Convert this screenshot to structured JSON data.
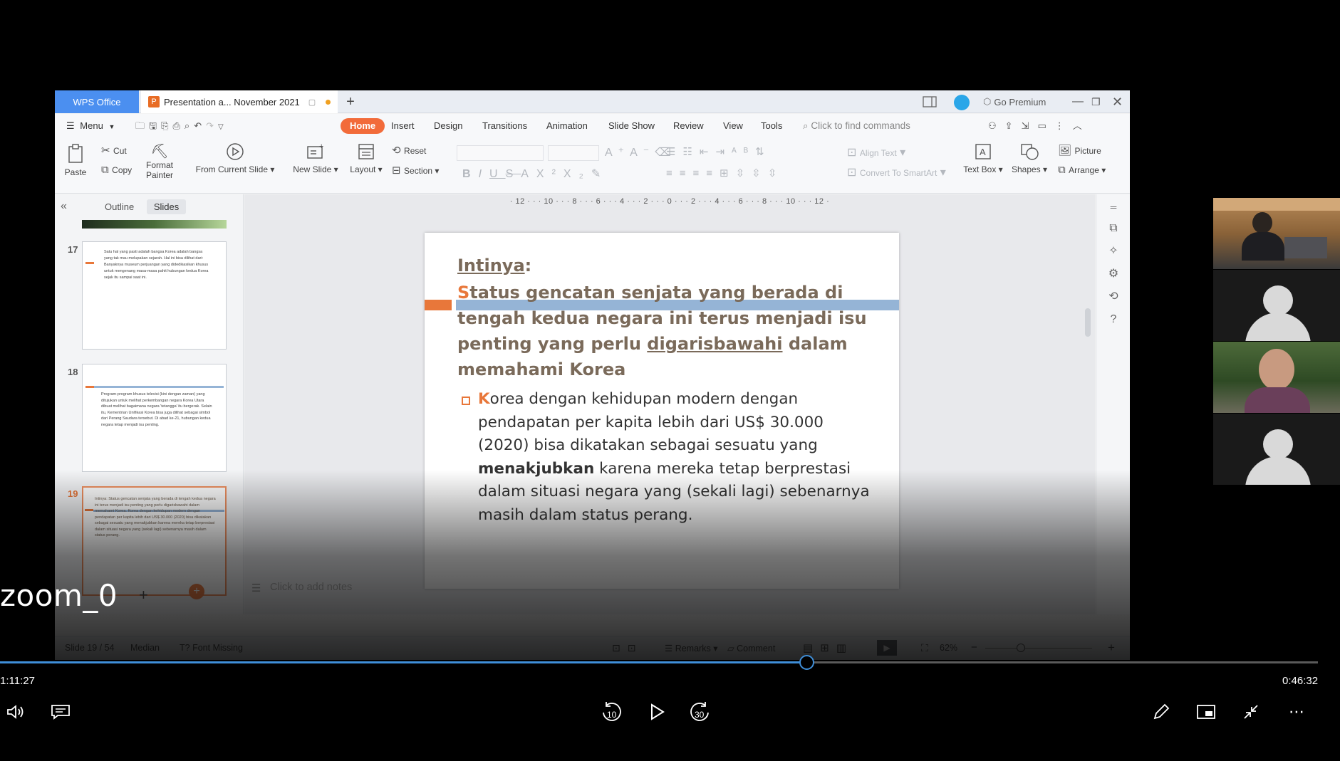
{
  "wps": {
    "app_tab": "WPS Office",
    "doc_tab": "Presentation a... November 2021",
    "go_premium": "Go Premium",
    "menu": "Menu",
    "tabs": [
      "Home",
      "Insert",
      "Design",
      "Transitions",
      "Animation",
      "Slide Show",
      "Review",
      "View",
      "Tools"
    ],
    "find_placeholder": "Click to find commands",
    "ribbon": {
      "paste": "Paste",
      "cut": "Cut",
      "copy": "Copy",
      "format_painter_1": "Format",
      "format_painter_2": "Painter",
      "from_current_slide": "From Current Slide",
      "new_slide": "New Slide",
      "layout": "Layout",
      "reset": "Reset",
      "section": "Section",
      "align_text": "Align Text",
      "convert_smartart": "Convert To SmartArt",
      "text_box": "Text Box",
      "shapes": "Shapes",
      "picture": "Picture",
      "arrange": "Arrange"
    },
    "panel_tabs": {
      "outline": "Outline",
      "slides": "Slides"
    },
    "thumbnails": [
      {
        "num": "17",
        "text": "Satu hal yang pasti adalah bangsa Korea adalah bangsa yang tak mau melupakan sejarah. Hal ini bisa dilihat dari: Banyaknya museum perjuangan yang didedikasikan khusus untuk mengenang masa-masa pahit hubungan kedua Korea sejak itu sampai saat ini."
      },
      {
        "num": "18",
        "text": "Program-program khusus televisi (kini dengan zaman) yang ditujukan untuk melihat perkembangan negara Korea Utara dibuat melihat bagaimana negara 'tetangga' itu bergerak. Selain itu, Kementrian Unifikasi Korea bisa juga dilihat sebagai simbol dari Perang Saudara tersebut. Di abad ke-21, hubungan kedua negara tetap menjadi isu penting."
      },
      {
        "num": "19",
        "text": "Intinya: Status gencatan senjata yang berada di tengah kedua negara ini terus menjadi isu penting yang perlu digarisbawahi dalam memahami Korea. Korea dengan kehidupan modern dengan pendapatan per kapita lebih dari US$ 30.000 (2020) bisa dikatakan sebagai sesuatu yang menakjubkan karena mereka tetap berprestasi dalam situasi negara yang (sekali lagi) sebenarnya masih dalam status perang."
      }
    ],
    "ruler": "· 12 · · · 10 · · · 8 · · · 6 · · · 4 · · · 2 · · · 0 · · · 2 · · · 4 · · · 6 · · · 8 · · · 10 · · · 12 ·",
    "slide": {
      "heading": "Intinya",
      "heading_colon": ":",
      "main_first_letter": "S",
      "main_rest_1": "tatus gencatan senjata yang berada di",
      "main_line_2": "tengah kedua negara ini terus menjadi isu",
      "main_line_3a": "penting yang perlu ",
      "main_line_3b": "digarisbawahi",
      "main_line_3c": " dalam",
      "main_line_4": "memahami Korea",
      "bullet_first_letter": "K",
      "bullet_l1": "orea dengan kehidupan modern dengan",
      "bullet_l2": "pendapatan per kapita lebih dari US$ 30.000",
      "bullet_l3": "(2020) bisa dikatakan sebagai sesuatu yang",
      "bullet_l4_bold": "menakjubkan",
      "bullet_l4_rest": " karena mereka tetap berprestasi",
      "bullet_l5": "dalam situasi negara yang (sekali lagi) sebenarnya",
      "bullet_l6": "masih dalam status perang."
    },
    "notes_placeholder": "Click to add notes",
    "status": {
      "slide_counter": "Slide 19 / 54",
      "theme": "Median",
      "font_missing": "Font Missing",
      "remarks": "Remarks",
      "comment": "Comment",
      "zoom": "62%"
    },
    "colors": {
      "accent": "#f26b3a",
      "title_text": "#7a6a5a",
      "bar_blue": "#95b4d6"
    }
  },
  "player": {
    "overlay_label": "zoom_0",
    "time_elapsed": "1:11:27",
    "time_total": "0:46:32",
    "progress_fraction": 0.612,
    "skip_back": "10",
    "skip_forward": "30"
  }
}
